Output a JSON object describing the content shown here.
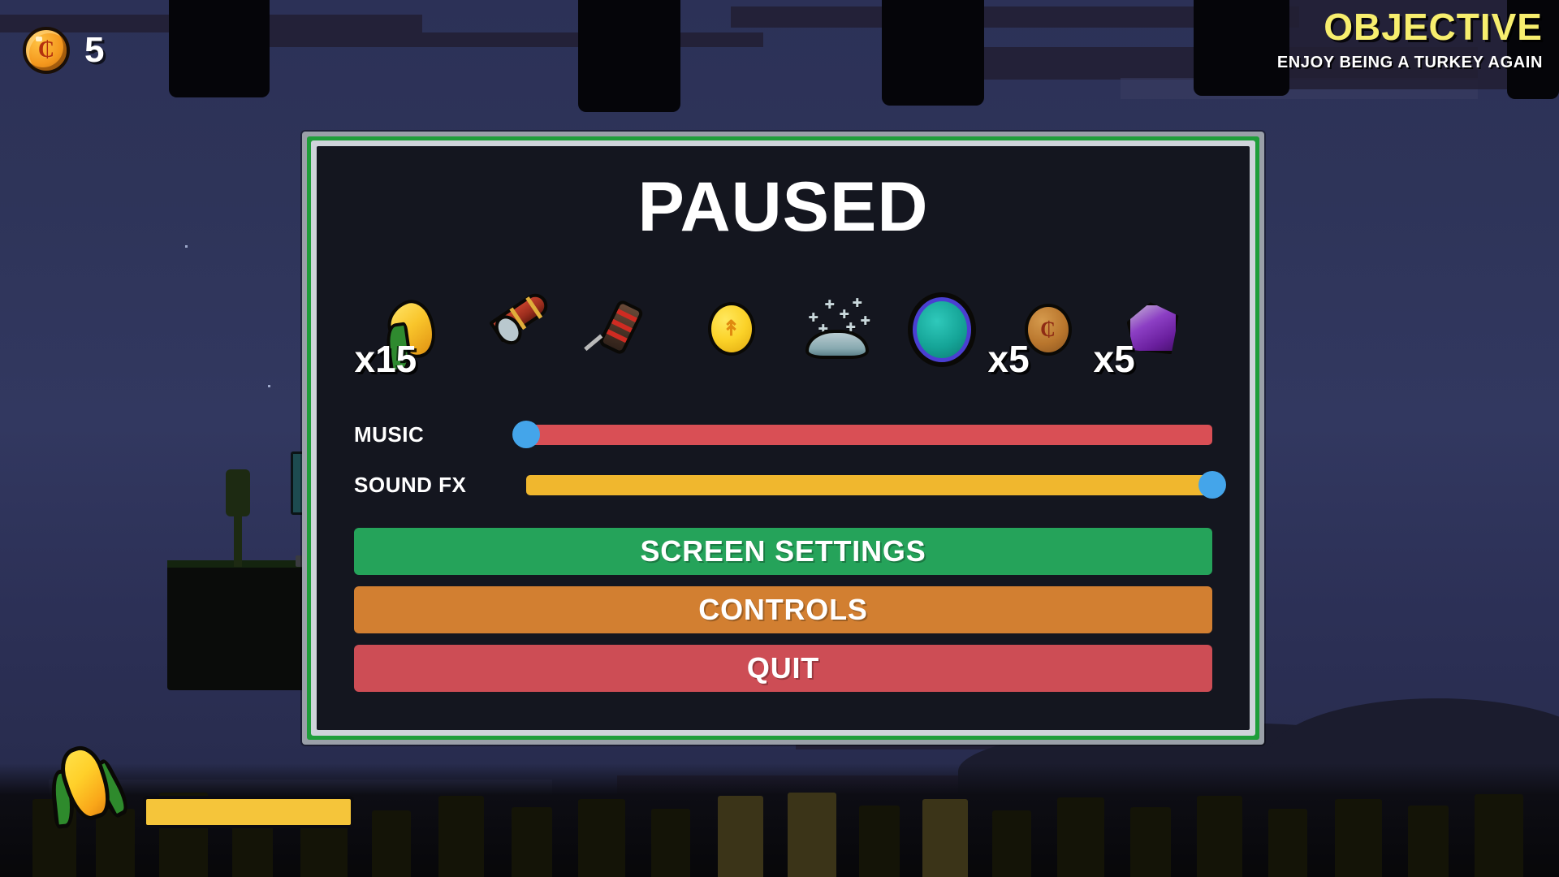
{
  "hud": {
    "coin": {
      "icon": "coin-icon",
      "glyph": "₵",
      "count": "5"
    },
    "objective": {
      "title": "OBJECTIVE",
      "subtitle": "ENJOY BEING A TURKEY AGAIN",
      "title_color": "#f7ee6e",
      "subtitle_color": "#ffffff"
    },
    "powerup": {
      "icon": "corn-icon",
      "bar_color": "#f5c53a"
    }
  },
  "panel": {
    "title": "PAUSED",
    "border_colors": {
      "outer": "#9aa0a8",
      "accent": "#1f9e3a",
      "inner_edge": "#cfd4da",
      "background": "#14161f"
    }
  },
  "inventory": {
    "items": [
      {
        "icon": "wheat-icon",
        "name": "Wheat",
        "count": "x15"
      },
      {
        "icon": "horn-icon",
        "name": "Horn",
        "count": ""
      },
      {
        "icon": "firecracker-icon",
        "name": "Firecracker",
        "count": ""
      },
      {
        "icon": "gold-coin-icon",
        "name": "Gold Coin",
        "count": ""
      },
      {
        "icon": "snow-cloud-icon",
        "name": "Snow Cloud",
        "count": ""
      },
      {
        "icon": "portal-orb-icon",
        "name": "Portal Orb",
        "count": ""
      },
      {
        "icon": "bronze-coin-icon",
        "name": "Bronze Coin",
        "count": "x5"
      },
      {
        "icon": "crystal-icon",
        "name": "Crystal",
        "count": "x5"
      }
    ]
  },
  "sliders": [
    {
      "label": "MUSIC",
      "value": 0,
      "track_color": "#d94f55",
      "handle_color": "#44a5ea"
    },
    {
      "label": "SOUND FX",
      "value": 100,
      "track_color": "#f0b72e",
      "handle_color": "#44a5ea"
    }
  ],
  "buttons": [
    {
      "label": "SCREEN SETTINGS",
      "color": "#25a35a",
      "style": "screen"
    },
    {
      "label": "CONTROLS",
      "color": "#d27f31",
      "style": "controls"
    },
    {
      "label": "QUIT",
      "color": "#cd4d55",
      "style": "quit"
    }
  ]
}
